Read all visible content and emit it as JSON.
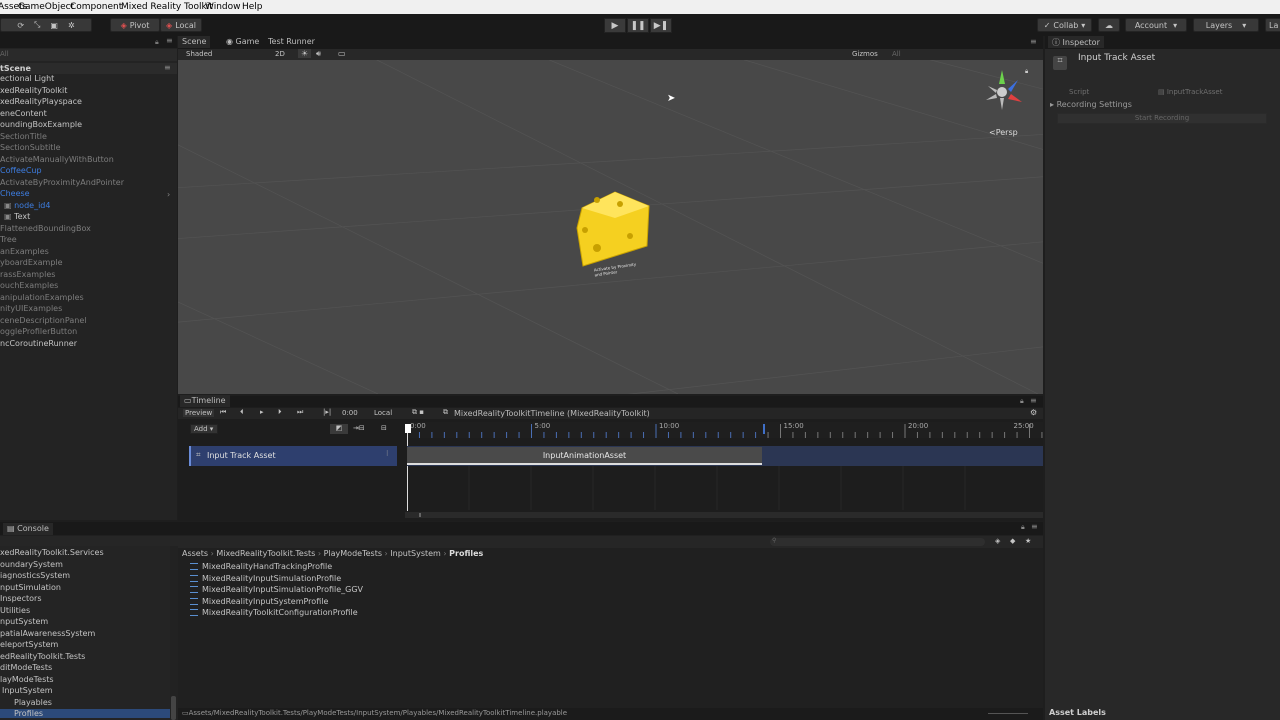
{
  "menu": {
    "items": [
      "Assets",
      "GameObject",
      "Component",
      "Mixed Reality Toolkit",
      "Window",
      "Help"
    ]
  },
  "toolbar": {
    "pivot": "Pivot",
    "local": "Local",
    "collab": "Collab",
    "account": "Account",
    "layers": "Layers",
    "layout": "La"
  },
  "hierarchy": {
    "scene_name": "tScene",
    "items": [
      {
        "label": "ectional Light",
        "style": ""
      },
      {
        "label": "xedRealityToolkit",
        "style": ""
      },
      {
        "label": "xedRealityPlayspace",
        "style": ""
      },
      {
        "label": "eneContent",
        "style": ""
      },
      {
        "label": "oundingBoxExample",
        "style": ""
      },
      {
        "label": "SectionTitle",
        "style": "dim"
      },
      {
        "label": "SectionSubtitle",
        "style": "dim"
      },
      {
        "label": "ActivateManuallyWithButton",
        "style": "dim"
      },
      {
        "label": "CoffeeCup",
        "style": "blue"
      },
      {
        "label": "ActivateByProximityAndPointer",
        "style": "dim"
      },
      {
        "label": "Cheese",
        "style": "blue"
      },
      {
        "label": "node_id4",
        "style": "blue"
      },
      {
        "label": "Text",
        "style": ""
      },
      {
        "label": "FlattenedBoundingBox",
        "style": "dim"
      },
      {
        "label": "Tree",
        "style": "dim"
      },
      {
        "label": "anExamples",
        "style": "dim"
      },
      {
        "label": "yboardExample",
        "style": "dim"
      },
      {
        "label": "rassExamples",
        "style": "dim"
      },
      {
        "label": "ouchExamples",
        "style": "dim"
      },
      {
        "label": "anipulationExamples",
        "style": "dim"
      },
      {
        "label": "nityUIExamples",
        "style": "dim"
      },
      {
        "label": "ceneDescriptionPanel",
        "style": "dim"
      },
      {
        "label": "oggleProfilerButton",
        "style": "dim"
      },
      {
        "label": "ncCoroutineRunner",
        "style": ""
      }
    ]
  },
  "scene_view": {
    "tabs": [
      "Scene",
      "Game",
      "Test Runner"
    ],
    "shading": "Shaded",
    "mode_2d": "2D",
    "gizmos": "Gizmos",
    "search_all": "All",
    "persp": "Persp",
    "text_on_object": "Activate by Proximity and Pointer"
  },
  "inspector": {
    "tab": "Inspector",
    "title": "Input Track Asset",
    "script_label": "Script",
    "script_value": "InputTrackAsset",
    "recording_settings": "Recording Settings",
    "start_recording": "Start Recording",
    "asset_labels": "Asset Labels"
  },
  "timeline": {
    "tab": "Timeline",
    "preview": "Preview",
    "time": "0:00",
    "local": "Local",
    "timeline_name": "MixedRealityToolkitTimeline (MixedRealityToolkit)",
    "add": "Add",
    "track_name": "Input Track Asset",
    "clip_name": "InputAnimationAsset",
    "ticks": [
      "0:00",
      "5:00",
      "10:00",
      "15:00",
      "20:00",
      "25:00"
    ]
  },
  "project": {
    "tab": "Console",
    "tree": [
      {
        "label": "xedRealityToolkit.Services"
      },
      {
        "label": "oundarySystem"
      },
      {
        "label": "iagnosticsSystem"
      },
      {
        "label": "nputSimulation"
      },
      {
        "label": "Inspectors"
      },
      {
        "label": "Utilities"
      },
      {
        "label": "nputSystem"
      },
      {
        "label": "patialAwarenessSystem"
      },
      {
        "label": "eleportSystem"
      },
      {
        "label": "edRealityToolkit.Tests"
      },
      {
        "label": "ditModeTests"
      },
      {
        "label": "layModeTests"
      },
      {
        "label": "InputSystem"
      },
      {
        "label": "Playables"
      },
      {
        "label": "Profiles"
      }
    ],
    "breadcrumb": [
      "Assets",
      "MixedRealityToolkit.Tests",
      "PlayModeTests",
      "InputSystem",
      "Profiles"
    ],
    "files": [
      "MixedRealityHandTrackingProfile",
      "MixedRealityInputSimulationProfile",
      "MixedRealityInputSimulationProfile_GGV",
      "MixedRealityInputSystemProfile",
      "MixedRealityToolkitConfigurationProfile"
    ],
    "status_path": "Assets/MixedRealityToolkit.Tests/PlayModeTests/InputSystem/Playables/MixedRealityToolkitTimeline.playable"
  },
  "colors": {
    "accent": "#3a72c8",
    "track": "#2e3f6e",
    "cheese": "#f5d020"
  }
}
